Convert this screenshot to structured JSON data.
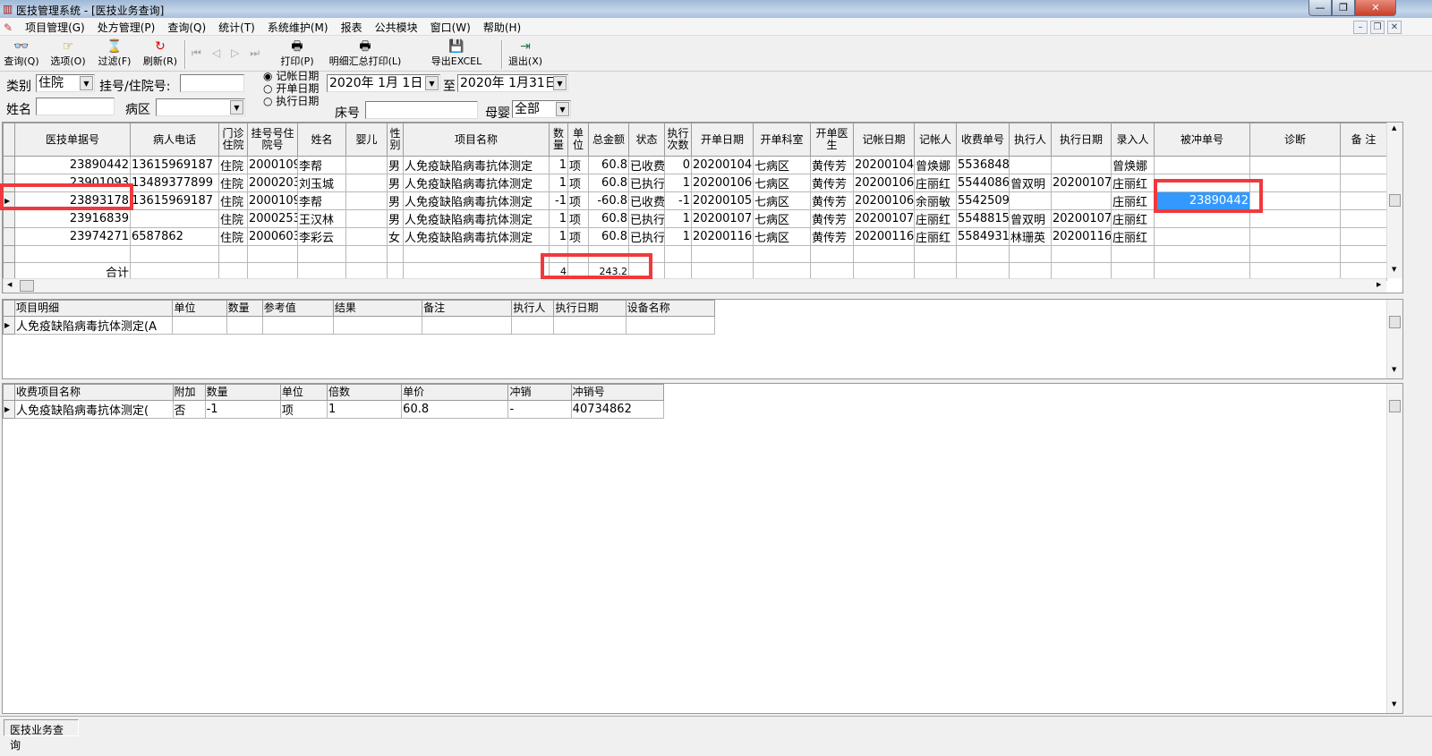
{
  "window": {
    "title": "医技管理系统 - [医技业务查询]",
    "minimize": "—",
    "restore": "❐",
    "close": "✕"
  },
  "menu": [
    "项目管理(G)",
    "处方管理(P)",
    "查询(Q)",
    "统计(T)",
    "系统维护(M)",
    "报表",
    "公共模块",
    "窗口(W)",
    "帮助(H)"
  ],
  "toolbar": [
    {
      "label": "查询(Q)",
      "icon": "binoculars-icon"
    },
    {
      "label": "选项(O)",
      "icon": "options-icon"
    },
    {
      "label": "过滤(F)",
      "icon": "hourglass-icon"
    },
    {
      "label": "刷新(R)",
      "icon": "refresh-icon"
    },
    {
      "label": "打印(P)",
      "icon": "printer-icon"
    },
    {
      "label": "明细汇总打印(L)",
      "icon": "printer-icon"
    },
    {
      "label": "导出EXCEL",
      "icon": "floppy-icon"
    },
    {
      "label": "退出(X)",
      "icon": "exit-icon"
    }
  ],
  "filters": {
    "category_label": "类别",
    "category_value": "住院",
    "reg_label": "挂号/住院号:",
    "reg_value": "",
    "name_label": "姓名",
    "name_value": "",
    "ward_label": "病区",
    "ward_value": "",
    "date_types": [
      "记帐日期",
      "开单日期",
      "执行日期"
    ],
    "date_type_selected": 0,
    "date_from": "2020年 1月 1日",
    "date_to_label": "至",
    "date_to": "2020年 1月31日",
    "bed_label": "床号",
    "bed_value": "",
    "mother_baby_label": "母婴",
    "mother_baby_value": "全部"
  },
  "main_grid": {
    "headers": [
      "医技单据号",
      "病人电话",
      "门诊住院",
      "挂号号住院号",
      "姓名",
      "婴儿",
      "性别",
      "项目名称",
      "数量",
      "单位",
      "总金额",
      "状态",
      "执行次数",
      "开单日期",
      "开单科室",
      "开单医生",
      "记帐日期",
      "记帐人",
      "收费单号",
      "执行人",
      "执行日期",
      "录入人",
      "被冲单号",
      "诊断",
      "备 注"
    ],
    "rows": [
      [
        "23890442",
        "13615969187",
        "住院",
        "2000109",
        "李帮",
        "",
        "男",
        "人免疫缺陷病毒抗体测定",
        "1",
        "项",
        "60.8",
        "已收费",
        "0",
        "20200104",
        "七病区",
        "黄传芳",
        "20200104",
        "曾焕娜",
        "5536848",
        "",
        "",
        "曾焕娜",
        "",
        "",
        ""
      ],
      [
        "23901093",
        "13489377899",
        "住院",
        "2000203",
        "刘玉城",
        "",
        "男",
        "人免疫缺陷病毒抗体测定",
        "1",
        "项",
        "60.8",
        "已执行",
        "1",
        "20200106",
        "七病区",
        "黄传芳",
        "20200106",
        "庄丽红",
        "5544086",
        "曾双明",
        "20200107",
        "庄丽红",
        "",
        "",
        ""
      ],
      [
        "23893178",
        "13615969187",
        "住院",
        "2000109",
        "李帮",
        "",
        "男",
        "人免疫缺陷病毒抗体测定",
        "-1",
        "项",
        "-60.8",
        "已收费",
        "-1",
        "20200105",
        "七病区",
        "黄传芳",
        "20200106",
        "余丽敏",
        "5542509",
        "",
        "",
        "庄丽红",
        "23890442",
        "",
        ""
      ],
      [
        "23916839",
        "",
        "住院",
        "2000253",
        "王汉林",
        "",
        "男",
        "人免疫缺陷病毒抗体测定",
        "1",
        "项",
        "60.8",
        "已执行",
        "1",
        "20200107",
        "七病区",
        "黄传芳",
        "20200107",
        "庄丽红",
        "5548815",
        "曾双明",
        "20200107",
        "庄丽红",
        "",
        "",
        ""
      ],
      [
        "23974271",
        "6587862",
        "住院",
        "2000603",
        "李彩云",
        "",
        "女",
        "人免疫缺陷病毒抗体测定",
        "1",
        "项",
        "60.8",
        "已执行",
        "1",
        "20200116",
        "七病区",
        "黄传芳",
        "20200116",
        "庄丽红",
        "5584931",
        "林珊英",
        "20200116",
        "庄丽红",
        "",
        "",
        ""
      ]
    ],
    "total_label": "合计",
    "total_qty": "4",
    "total_amount": "243.2",
    "current_row": 2
  },
  "detail_grid": {
    "headers": [
      "项目明细",
      "单位",
      "数量",
      "参考值",
      "结果",
      "备注",
      "执行人",
      "执行日期",
      "设备名称"
    ],
    "rows": [
      [
        "人免疫缺陷病毒抗体测定(A",
        "",
        "",
        "",
        "",
        "",
        "",
        "",
        ""
      ]
    ]
  },
  "charge_grid": {
    "headers": [
      "收费项目名称",
      "附加",
      "数量",
      "单位",
      "倍数",
      "单价",
      "冲销",
      "冲销号"
    ],
    "rows": [
      [
        "人免疫缺陷病毒抗体测定(",
        "否",
        "-1",
        "项",
        "1",
        "60.8",
        "-",
        "40734862"
      ]
    ]
  },
  "status": {
    "panel": "医技业务查询"
  },
  "colors": {
    "highlight": "#3399ff",
    "annotation": "#f0393d"
  }
}
